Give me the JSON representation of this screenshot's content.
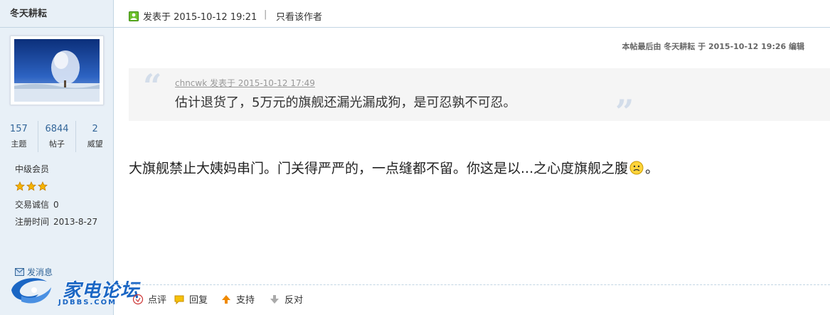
{
  "user": {
    "name": "冬天耕耘",
    "stats": [
      {
        "value": "157",
        "label": "主题"
      },
      {
        "value": "6844",
        "label": "帖子"
      },
      {
        "value": "2",
        "label": "威望"
      }
    ],
    "group": "中级会员",
    "star_count": 3,
    "trade_label": "交易诚信",
    "trade_value": "0",
    "reg_label": "注册时间",
    "reg_value": "2013-8-27",
    "message_link": "发消息"
  },
  "logo": {
    "brand": "家电论坛",
    "sub": "JDBBS.COM",
    "color": "#1a66c4"
  },
  "post": {
    "posted_at": "发表于 2015-10-12 19:21",
    "separator": "|",
    "author_only": "只看该作者",
    "edited_note": "本帖最后由 冬天耕耘 于 2015-10-12 19:26 编辑",
    "quote": {
      "meta": "chncwk 发表于 2015-10-12 17:49",
      "text": "估计退货了，5万元的旗舰还漏光漏成狗，是可忍孰不可忍。",
      "open_mark": "“",
      "close_mark": "”"
    },
    "body_before_emoji": "大旗舰禁止大姨妈串门。门关得严严的，一点缝都不留。你这是以...之心度旗舰之腹",
    "body_after_emoji": "。",
    "emoji_icon": "confused-face-icon"
  },
  "actions": [
    {
      "label": "点评",
      "icon": "comment-icon"
    },
    {
      "label": "回复",
      "icon": "reply-bubble-icon"
    },
    {
      "label": "支持",
      "icon": "thumbs-up-arrow-icon"
    },
    {
      "label": "反对",
      "icon": "thumbs-down-arrow-icon"
    }
  ],
  "colors": {
    "sidebar_bg": "#e8f0f7",
    "border": "#c2d5e3",
    "link": "#336699",
    "star": "#f5b400"
  }
}
